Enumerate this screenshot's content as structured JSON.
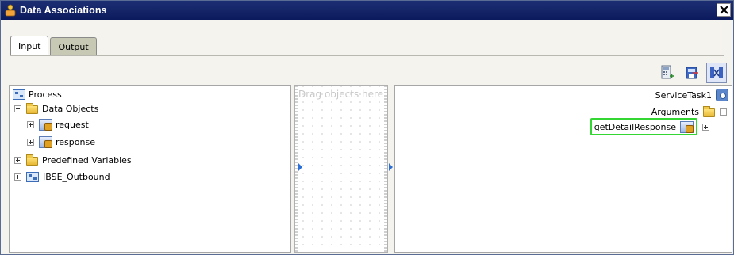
{
  "window": {
    "title": "Data Associations",
    "close_glyph": "✕"
  },
  "tabs": [
    {
      "label": "Input",
      "active": true
    },
    {
      "label": "Output",
      "active": false
    }
  ],
  "toolbar": {
    "buttons": [
      {
        "icon": "expression-builder-icon",
        "pressed": false
      },
      {
        "icon": "copy-to-icon",
        "pressed": false
      },
      {
        "icon": "mapping-view-icon",
        "pressed": true
      }
    ]
  },
  "left_tree": {
    "root": "Process",
    "data_objects": "Data Objects",
    "request": "request",
    "response": "response",
    "predefined": "Predefined Variables",
    "ibse": "IBSE_Outbound"
  },
  "middle": {
    "placeholder": "Drag objects here"
  },
  "right_tree": {
    "service_task": "ServiceTask1",
    "arguments": "Arguments",
    "response_arg": "getDetailResponse"
  }
}
